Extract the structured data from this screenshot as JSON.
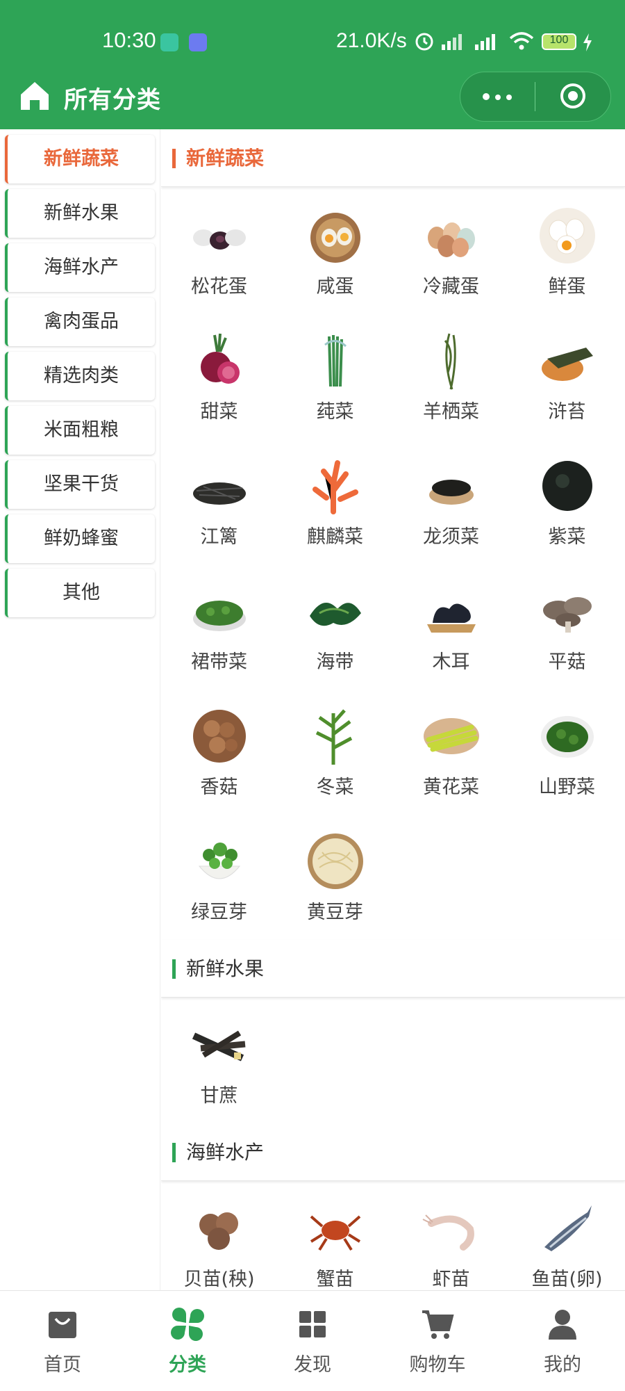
{
  "status_bar": {
    "time": "10:30",
    "network_speed": "21.0K/s",
    "battery": "100"
  },
  "header": {
    "title": "所有分类"
  },
  "sidebar": {
    "items": [
      {
        "label": "新鲜蔬菜",
        "active": true
      },
      {
        "label": "新鲜水果",
        "active": false
      },
      {
        "label": "海鲜水产",
        "active": false
      },
      {
        "label": "禽肉蛋品",
        "active": false
      },
      {
        "label": "精选肉类",
        "active": false
      },
      {
        "label": "米面粗粮",
        "active": false
      },
      {
        "label": "坚果干货",
        "active": false
      },
      {
        "label": "鲜奶蜂蜜",
        "active": false
      },
      {
        "label": "其他",
        "active": false
      }
    ]
  },
  "sections": [
    {
      "title": "新鲜蔬菜",
      "items": [
        "松花蛋",
        "咸蛋",
        "冷藏蛋",
        "鲜蛋",
        "甜菜",
        "莼菜",
        "羊栖菜",
        "浒苔",
        "江篱",
        "麒麟菜",
        "龙须菜",
        "紫菜",
        "裙带菜",
        "海带",
        "木耳",
        "平菇",
        "香菇",
        "冬菜",
        "黄花菜",
        "山野菜",
        "绿豆芽",
        "黄豆芽"
      ]
    },
    {
      "title": "新鲜水果",
      "items": [
        "甘蔗"
      ]
    },
    {
      "title": "海鲜水产",
      "items": [
        "贝苗(秧)",
        "蟹苗",
        "虾苗",
        "鱼苗(卵)"
      ]
    }
  ],
  "tabbar": {
    "tabs": [
      {
        "label": "首页",
        "icon": "bag-icon",
        "active": false
      },
      {
        "label": "分类",
        "icon": "clover-icon",
        "active": true
      },
      {
        "label": "发现",
        "icon": "grid-icon",
        "active": false
      },
      {
        "label": "购物车",
        "icon": "cart-icon",
        "active": false
      },
      {
        "label": "我的",
        "icon": "user-icon",
        "active": false
      }
    ]
  },
  "colors": {
    "brand_green": "#2ea456",
    "active_orange": "#e9683b"
  }
}
